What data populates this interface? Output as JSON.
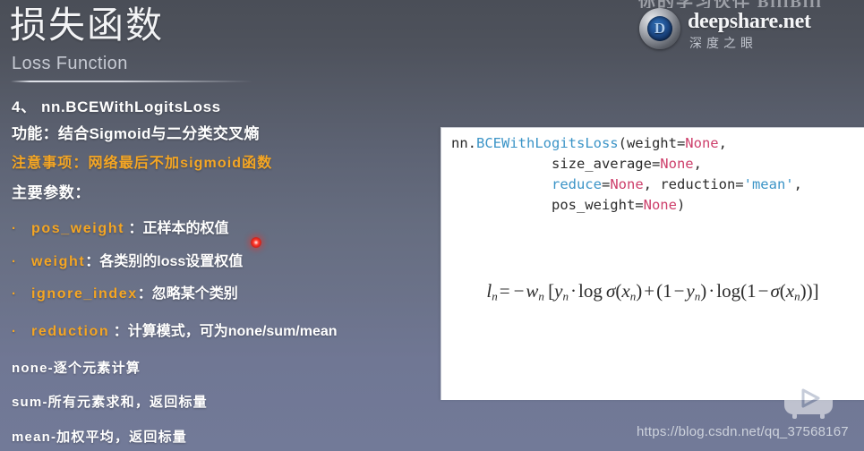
{
  "header": {
    "title": "损失函数",
    "subtitle": "Loss Function"
  },
  "brand": {
    "mark_letter": "D",
    "name": "deepshare.net",
    "sub": "深度之眼",
    "top_watermark": "你的学习伙伴 BiliBili"
  },
  "content": {
    "heading_num": "4、  nn.BCEWithLogitsLoss",
    "heading_func": "功能：结合Sigmoid与二分类交叉熵",
    "heading_note": "注意事项：网络最后不加sigmoid函数",
    "heading_param": "主要参数：",
    "bullet_char": "·",
    "bullets": [
      {
        "keyword": "pos_weight",
        "desc": " ：正样本的权值"
      },
      {
        "keyword": "weight",
        "desc": "：各类别的loss设置权值"
      },
      {
        "keyword": "ignore_index",
        "desc": "：忽略某个类别"
      },
      {
        "keyword": "reduction",
        "desc": " ：计算模式，可为none/sum/mean"
      }
    ],
    "footnotes": [
      "none-逐个元素计算",
      "sum-所有元素求和，返回标量",
      "mean-加权平均，返回标量"
    ]
  },
  "panel": {
    "code": {
      "line1_pre": "nn.",
      "line1_cls": "BCEWithLogitsLoss",
      "line1_post": "(weight=",
      "line1_none": "None",
      "line1_end": ",",
      "line2_pre": "            size_average=",
      "line2_none": "None",
      "line2_end": ",",
      "line3_indent": "            ",
      "line3_arg": "reduce",
      "line3_eq": "=",
      "line3_none": "None",
      "line3_mid": ", reduction=",
      "line3_str": "'mean'",
      "line3_end": ",",
      "line4_pre": "            pos_weight=",
      "line4_none": "None",
      "line4_end": ")"
    },
    "formula_plain": "l_n = -w_n [y_n · log σ(x_n) + (1 - y_n) · log(1 - σ(x_n))]"
  },
  "watermark": {
    "url": "https://blog.csdn.net/qq_37568167"
  },
  "colors": {
    "accent_orange": "#f5a623",
    "code_class_blue": "#3b94c7",
    "code_none_pink": "#cd3f6b",
    "panel_bg": "#ffffff",
    "laser_red": "#ff3b2e"
  }
}
